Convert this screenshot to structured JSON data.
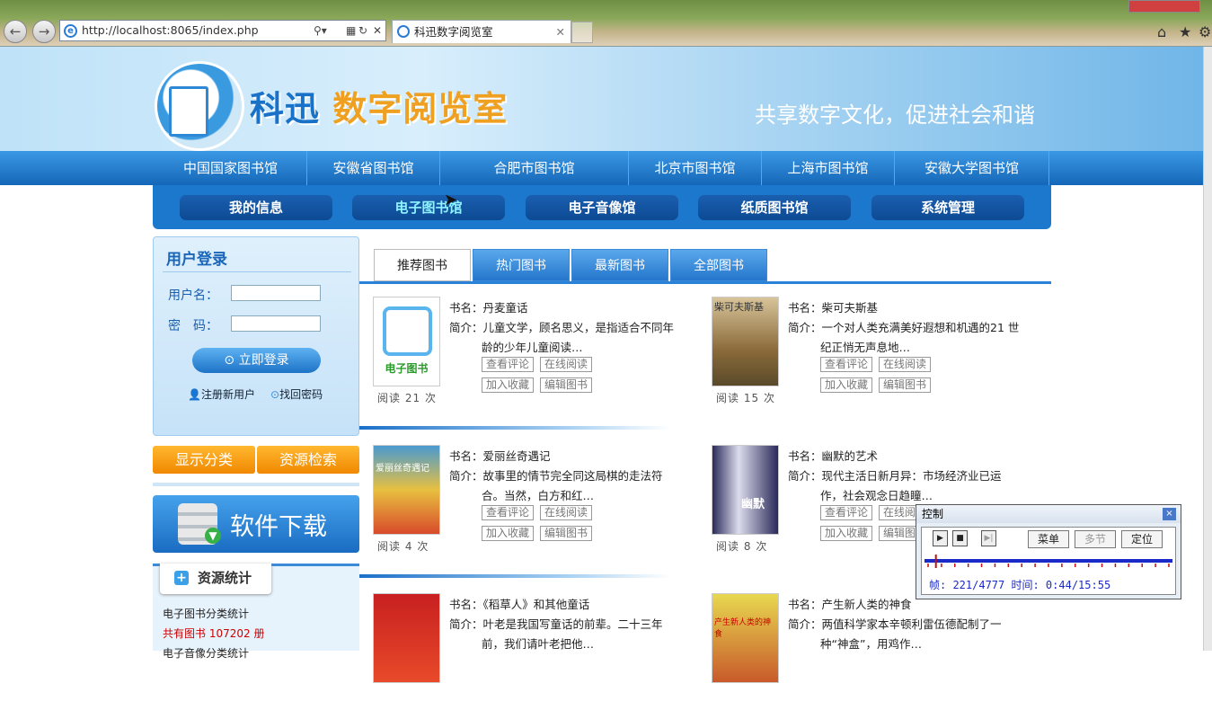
{
  "browser": {
    "url": "http://localhost:8065/index.php",
    "tab_title": "科迅数字阅览室",
    "tab_close": "✕"
  },
  "header": {
    "title_part1": "科迅",
    "title_part2": "数字阅览室",
    "slogan": "共享数字文化，促进社会和谐"
  },
  "libraries": [
    "中国国家图书馆",
    "安徽省图书馆",
    "合肥市图书馆",
    "北京市图书馆",
    "上海市图书馆",
    "安徽大学图书馆"
  ],
  "main_nav": [
    "我的信息",
    "电子图书馆",
    "电子音像馆",
    "纸质图书馆",
    "系统管理"
  ],
  "active_main_nav": "电子图书馆",
  "login": {
    "title": "用户登录",
    "username_label": "用户名：",
    "password_label": "密　码：",
    "submit": "立即登录",
    "register": "注册新用户",
    "recover": "找回密码"
  },
  "category_buttons": [
    "显示分类",
    "资源检索"
  ],
  "download": {
    "label": "软件下载"
  },
  "stats": {
    "title": "资源统计",
    "line1": "电子图书分类统计",
    "line2_prefix": "共有图书",
    "line2_count": "107202",
    "line2_unit": "册",
    "line3": "电子音像分类统计"
  },
  "book_tabs": [
    "推荐图书",
    "热门图书",
    "最新图书",
    "全部图书"
  ],
  "active_book_tab": "推荐图书",
  "labels": {
    "name": "书名：",
    "intro": "简介：",
    "read_prefix": "阅读",
    "read_suffix": "次",
    "ebook_cover": "电子图书"
  },
  "book_actions": [
    "查看评论",
    "在线阅读",
    "加入收藏",
    "编辑图书"
  ],
  "books": [
    {
      "name": "丹麦童话",
      "intro": "儿童文学，顾名思义，是指适合不同年龄的少年儿童阅读…",
      "reads": "21",
      "cover": "ebook"
    },
    {
      "name": "柴可夫斯基",
      "intro": "一个对人类充满美好遐想和机遇的21 世纪正悄无声息地…",
      "reads": "15",
      "cover_text": "柴可夫斯基",
      "cover": "photo"
    },
    {
      "name": "爱丽丝奇遇记",
      "intro": "故事里的情节完全同这局棋的走法符合。当然，白方和红…",
      "reads": "4",
      "cover_text": "爱丽丝奇遇记",
      "cover": "photo"
    },
    {
      "name": "幽默的艺术",
      "intro": "现代主活日新月异：市场经济业已运作，社会观念日趋瞳…",
      "reads": "8",
      "cover_text": "幽默",
      "cover": "photo"
    },
    {
      "name": "《稻草人》和其他童话",
      "intro": "叶老是我国写童话的前辈。二十三年前，我们请叶老把他…",
      "reads": "",
      "cover": "photo"
    },
    {
      "name": "产生新人类的神食",
      "intro": "两值科学家本辛顿利雷伍德配制了一种“神盒”，用鸡作…",
      "reads": "",
      "cover_text": "产生新人类的神食",
      "cover": "photo"
    }
  ],
  "player": {
    "title": "控制",
    "close": "×",
    "menu": "菜单",
    "multi": "多节",
    "locate": "定位",
    "frame_info": "帧: 221/4777 时间: 0:44/15:55",
    "progress": 0.046
  }
}
